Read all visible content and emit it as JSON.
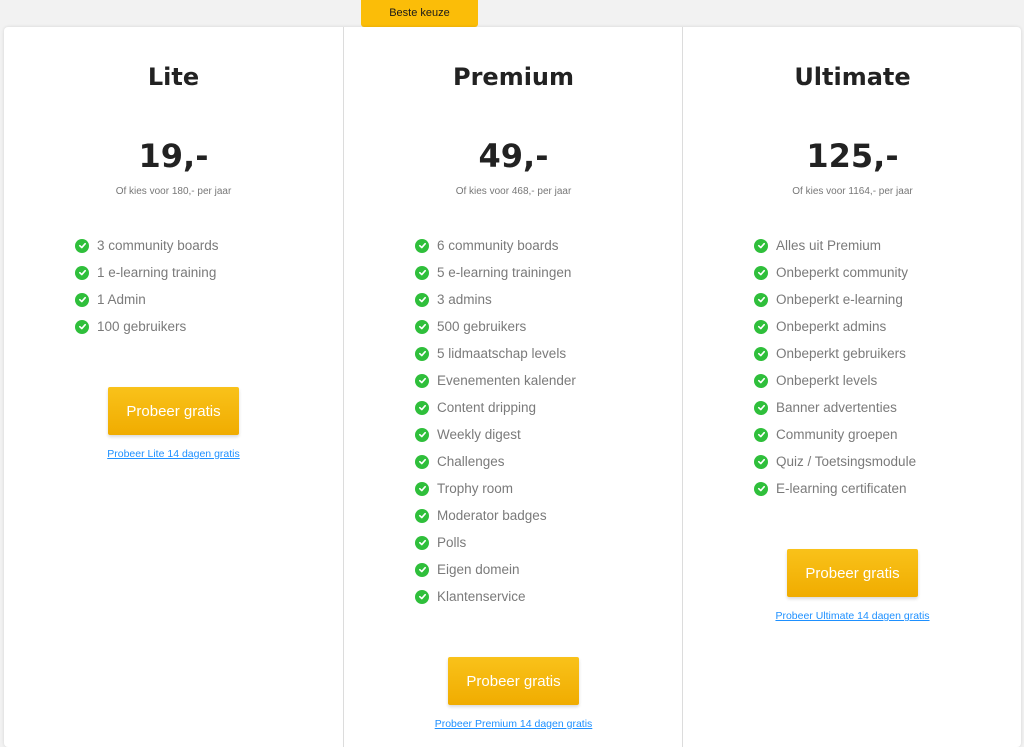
{
  "badge": "Beste keuze",
  "plans": [
    {
      "name": "Lite",
      "price": "19,-",
      "yearly": "Of kies voor 180,-  per jaar",
      "features": [
        "3 community boards",
        "1 e-learning training",
        "1 Admin",
        "100 gebruikers"
      ],
      "cta": "Probeer gratis",
      "trial": "Probeer Lite 14 dagen gratis"
    },
    {
      "name": "Premium",
      "price": "49,-",
      "yearly": "Of kies voor 468,-  per jaar",
      "features": [
        "6 community boards",
        "5 e-learning trainingen",
        "3 admins",
        "500 gebruikers",
        "5 lidmaatschap levels",
        "Evenementen kalender",
        "Content dripping",
        "Weekly digest",
        "Challenges",
        "Trophy room",
        "Moderator badges",
        "Polls",
        "Eigen domein",
        "Klantenservice"
      ],
      "cta": "Probeer gratis",
      "trial": "Probeer Premium 14 dagen gratis"
    },
    {
      "name": "Ultimate",
      "price": "125,-",
      "yearly": "Of kies voor 1164,-  per jaar",
      "features": [
        "Alles uit Premium",
        "Onbeperkt community",
        "Onbeperkt e-learning",
        "Onbeperkt admins",
        "Onbeperkt gebruikers",
        "Onbeperkt levels",
        "Banner advertenties",
        "Community groepen",
        "Quiz / Toetsingsmodule",
        "E-learning certificaten"
      ],
      "cta": "Probeer gratis",
      "trial": "Probeer Ultimate 14 dagen gratis"
    }
  ],
  "icons": {
    "feature": "check-circle-icon"
  },
  "colors": {
    "accent": "#fbbd08",
    "check": "#2fbf3b",
    "link": "#1e90ff"
  }
}
